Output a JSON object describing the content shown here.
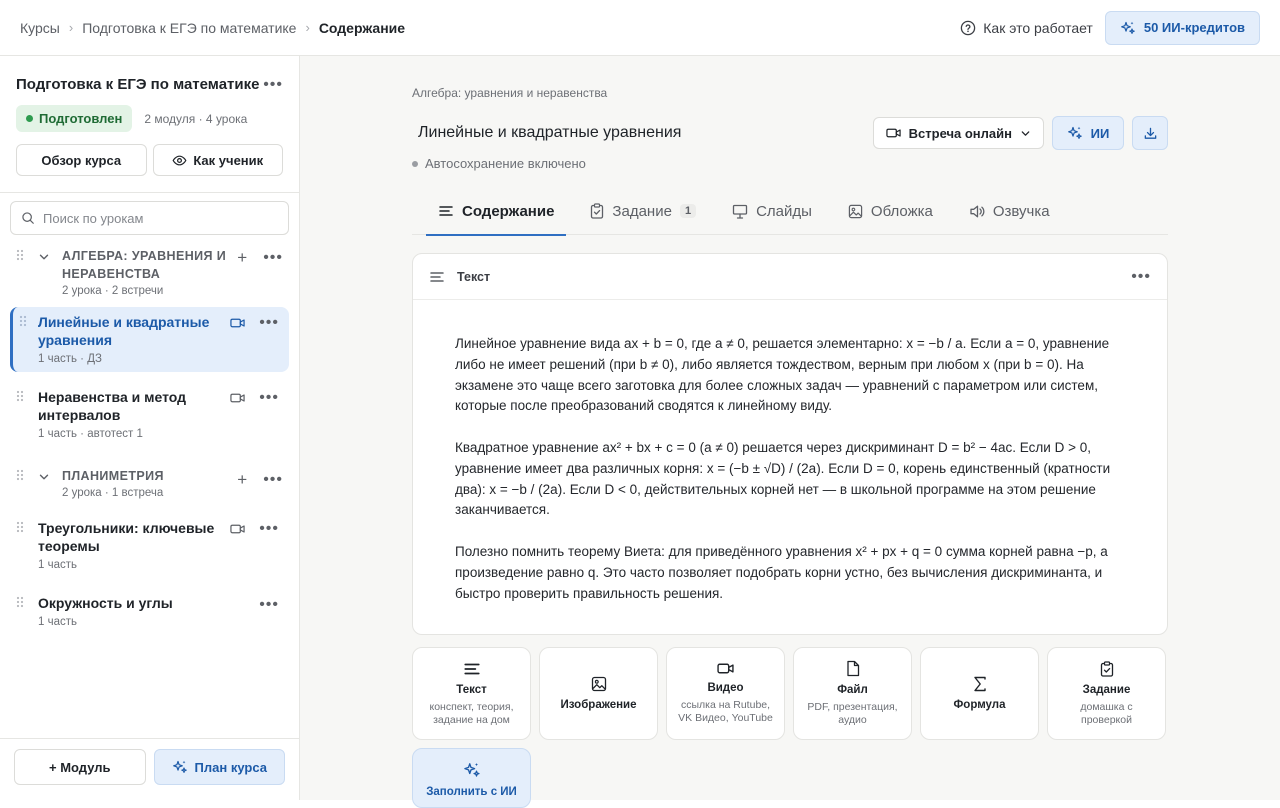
{
  "breadcrumbs": [
    "Курсы",
    "Подготовка к ЕГЭ по математике",
    "Содержание"
  ],
  "header": {
    "how_label": "Как это работает",
    "credits_label": "50 ИИ-кредитов"
  },
  "sidebar": {
    "course_title": "Подготовка к ЕГЭ по математике",
    "status": "Подготовлен",
    "stats": "2 модуля · 4 урока",
    "overview_label": "Обзор курса",
    "student_label": "Как ученик",
    "search_placeholder": "Поиск по урокам",
    "modules": [
      {
        "title": "АЛГЕБРА: УРАВНЕНИЯ И НЕРАВЕНСТВА",
        "meta": "2 урока · 2 встречи",
        "lessons": [
          {
            "title": "Линейные и квадратные уравнения",
            "meta": "1 часть · ДЗ"
          },
          {
            "title": "Неравенства и метод интервалов",
            "meta": "1 часть · автотест 1"
          }
        ]
      },
      {
        "title": "ПЛАНИМЕТРИЯ",
        "meta": "2 урока · 1 встреча",
        "lessons": [
          {
            "title": "Треугольники: ключевые теоремы",
            "meta": "1 часть"
          },
          {
            "title": "Окружность и углы",
            "meta": "1 часть"
          }
        ]
      }
    ],
    "add_module_label": "+ Модуль",
    "plan_label": "План курса"
  },
  "main": {
    "module_name": "Алгебра: уравнения и неравенства",
    "lesson_title": "Линейные и квадратные уравнения",
    "meeting_label": "Встреча онлайн",
    "ai_label": "ИИ",
    "autosave": "Автосохранение включено",
    "tabs": [
      {
        "label": "Содержание"
      },
      {
        "label": "Задание",
        "count": "1"
      },
      {
        "label": "Слайды"
      },
      {
        "label": "Обложка"
      },
      {
        "label": "Озвучка"
      }
    ],
    "text_block": {
      "label": "Текст",
      "paragraphs": [
        "Линейное уравнение вида ax + b = 0, где a ≠ 0, решается элементарно: x = −b / a. Если a = 0, уравнение либо не имеет решений (при b ≠ 0), либо является тождеством, верным при любом x (при b = 0). На экзамене это чаще всего заготовка для более сложных задач — уравнений с параметром или систем, которые после преобразований сводятся к линейному виду.",
        "Квадратное уравнение ax² + bx + c = 0 (a ≠ 0) решается через дискриминант D = b² − 4ac. Если D > 0, уравнение имеет два различных корня: x = (−b ± √D) / (2a). Если D = 0, корень единственный (кратности два): x = −b / (2a). Если D < 0, действительных корней нет — в школьной программе на этом решение заканчивается.",
        "Полезно помнить теорему Виета: для приведённого уравнения x² + px + q = 0 сумма корней равна −p, а произведение равно q. Это часто позволяет подобрать корни устно, без вычисления дискриминанта, и быстро проверить правильность решения."
      ]
    },
    "add_blocks": [
      {
        "title": "Текст",
        "sub": "конспект, теория, задание на дом",
        "icon": "text-icon"
      },
      {
        "title": "Изображение",
        "sub": "",
        "icon": "image-icon"
      },
      {
        "title": "Видео",
        "sub": "ссылка на Rutube, VK Видео, YouTube",
        "icon": "video-icon"
      },
      {
        "title": "Файл",
        "sub": "PDF, презентация, аудио",
        "icon": "file-icon"
      },
      {
        "title": "Формула",
        "sub": "",
        "icon": "sigma-icon"
      },
      {
        "title": "Задание",
        "sub": "домашка с проверкой",
        "icon": "clipboard-icon"
      }
    ],
    "ai_fill_label": "Заполнить с ИИ"
  },
  "colors": {
    "accent": "#2f6fc2",
    "accent_bg": "#e4eefb",
    "success": "#2e9b4f",
    "success_bg": "#e3f3e6"
  }
}
